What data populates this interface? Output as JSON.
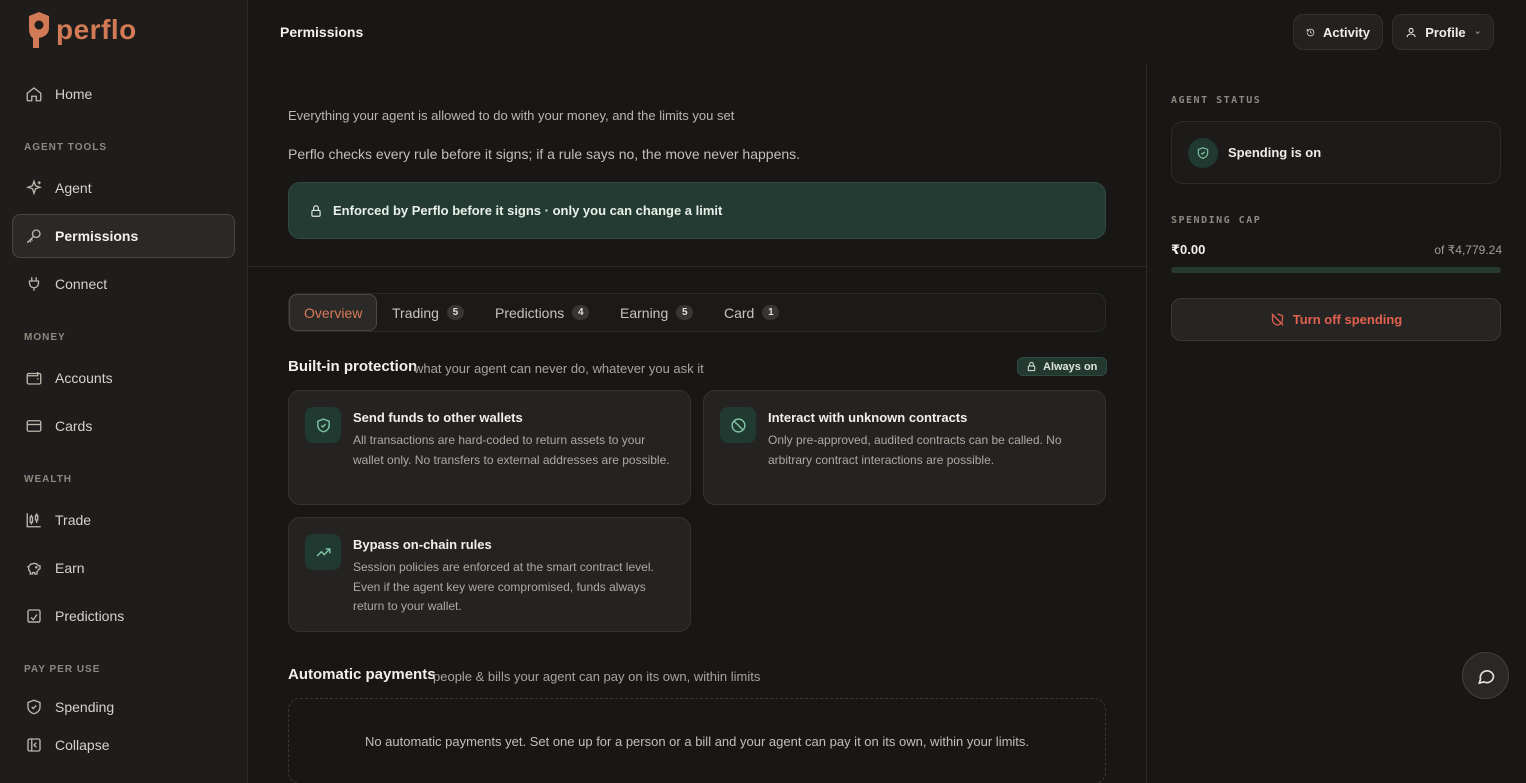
{
  "brand": {
    "name": "perflo",
    "color": "#d27a55"
  },
  "sidebar": {
    "home": "Home",
    "sections": {
      "agent_tools": "AGENT TOOLS",
      "money": "MONEY",
      "wealth": "WEALTH",
      "pay_per_use": "PAY PER USE"
    },
    "items": {
      "agent": "Agent",
      "permissions": "Permissions",
      "connect": "Connect",
      "accounts": "Accounts",
      "cards": "Cards",
      "trade": "Trade",
      "earn": "Earn",
      "predictions": "Predictions",
      "spending": "Spending"
    },
    "collapse": "Collapse",
    "active_item": "Permissions"
  },
  "header": {
    "title": "Permissions",
    "activity_label": "Activity",
    "profile_label": "Profile"
  },
  "intro": {
    "line1": "Everything your agent is allowed to do with your money, and the limits you set",
    "line2": "Perflo checks every rule before it signs; if a rule says no, the move never happens.",
    "banner": "Enforced by Perflo before it signs · only you can change a limit"
  },
  "tabs": [
    {
      "label": "Overview",
      "count": null,
      "active": true
    },
    {
      "label": "Trading",
      "count": "5"
    },
    {
      "label": "Predictions",
      "count": "4"
    },
    {
      "label": "Earning",
      "count": "5"
    },
    {
      "label": "Card",
      "count": "1"
    }
  ],
  "protection": {
    "title": "Built-in protection",
    "subtitle": "what your agent can never do, whatever you ask it",
    "badge": "Always on",
    "cards": [
      {
        "icon": "shield-check-icon",
        "title": "Send funds to other wallets",
        "desc": "All transactions are hard-coded to return assets to your wallet only. No transfers to external addresses are possible."
      },
      {
        "icon": "ban-icon",
        "title": "Interact with unknown contracts",
        "desc": "Only pre-approved, audited contracts can be called. No arbitrary contract interactions are possible."
      },
      {
        "icon": "trending-up-icon",
        "title": "Bypass on-chain rules",
        "desc": "Session policies are enforced at the smart contract level. Even if the agent key were compromised, funds always return to your wallet."
      }
    ]
  },
  "auto_payments": {
    "title": "Automatic payments",
    "subtitle": "people & bills your agent can pay on its own, within limits",
    "empty": "No automatic payments yet. Set one up for a person or a bill and your agent can pay it on its own, within your limits."
  },
  "right_panel": {
    "status_label": "AGENT STATUS",
    "status_text": "Spending is on",
    "cap_label": "SPENDING CAP",
    "cap_amount": "₹0.00",
    "cap_of": "of ₹4,779.24",
    "cap_fraction": 0,
    "turn_off": "Turn off spending"
  },
  "colors": {
    "accent": "#d87b57",
    "green_bg": "#243b33",
    "green_icon": "#7fc4a5",
    "danger": "#e0614e"
  }
}
